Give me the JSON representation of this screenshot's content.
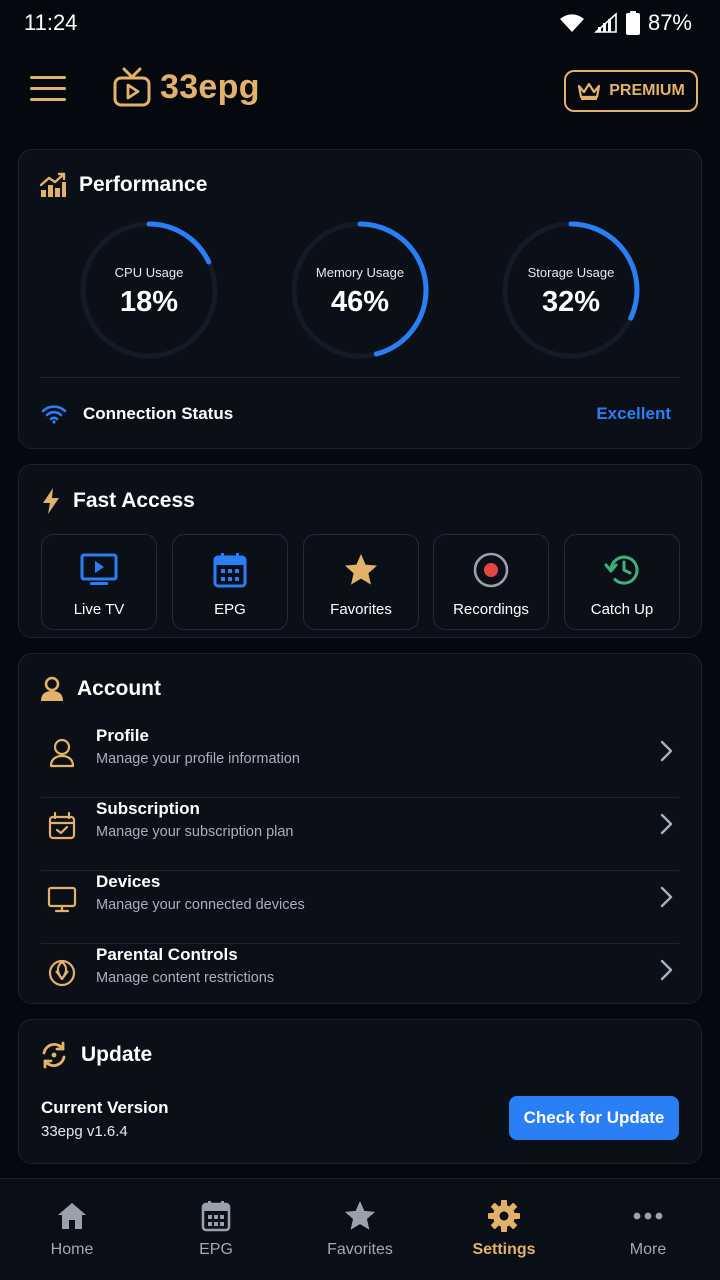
{
  "status_bar": {
    "time": "11:24",
    "battery": "87%"
  },
  "header": {
    "app_name": "33epg",
    "premium_label": "PREMIUM"
  },
  "colors": {
    "accent_gold": "#e3b26a",
    "accent_blue": "#2b7ff5",
    "background": "#05080f",
    "card": "#0b0f18"
  },
  "performance": {
    "title": "Performance",
    "gauges": [
      {
        "label": "CPU Usage",
        "value": "18%",
        "fraction": 0.18
      },
      {
        "label": "Memory Usage",
        "value": "46%",
        "fraction": 0.46
      },
      {
        "label": "Storage Usage",
        "value": "32%",
        "fraction": 0.32
      }
    ],
    "connection_label": "Connection Status",
    "connection_value": "Excellent"
  },
  "fast_access": {
    "title": "Fast Access",
    "items": [
      {
        "label": "Live TV",
        "icon": "tv-play-icon"
      },
      {
        "label": "EPG",
        "icon": "calendar-grid-icon"
      },
      {
        "label": "Favorites",
        "icon": "star-icon"
      },
      {
        "label": "Recordings",
        "icon": "record-icon"
      },
      {
        "label": "Catch Up",
        "icon": "history-icon"
      }
    ]
  },
  "account": {
    "title": "Account",
    "items": [
      {
        "title": "Profile",
        "subtitle": "Manage your profile information",
        "icon": "person-icon"
      },
      {
        "title": "Subscription",
        "subtitle": "Manage your subscription plan",
        "icon": "subscription-icon"
      },
      {
        "title": "Devices",
        "subtitle": "Manage your connected devices",
        "icon": "monitor-icon"
      },
      {
        "title": "Parental Controls",
        "subtitle": "Manage content restrictions",
        "icon": "parental-icon"
      }
    ]
  },
  "update": {
    "title": "Update",
    "version_label": "Current Version",
    "version_value": "33epg v1.6.4",
    "button_label": "Check for Update"
  },
  "bottom_nav": {
    "items": [
      {
        "label": "Home",
        "icon": "home-icon"
      },
      {
        "label": "EPG",
        "icon": "calendar-icon"
      },
      {
        "label": "Favorites",
        "icon": "star-icon"
      },
      {
        "label": "Settings",
        "icon": "gear-icon",
        "active": true
      },
      {
        "label": "More",
        "icon": "more-icon"
      }
    ]
  }
}
